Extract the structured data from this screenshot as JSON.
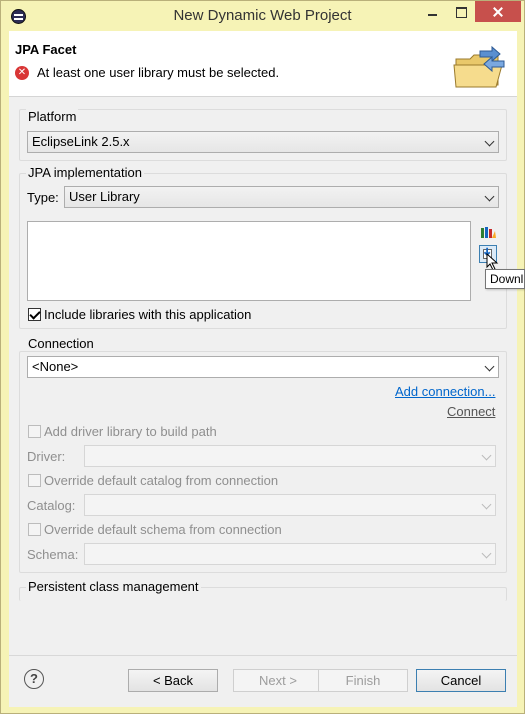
{
  "window": {
    "title": "New Dynamic Web Project"
  },
  "banner": {
    "title": "JPA Facet",
    "error_message": "At least one user library must be selected."
  },
  "platform": {
    "label": "Platform",
    "selected": "EclipseLink 2.5.x"
  },
  "jpa_impl": {
    "label": "JPA implementation",
    "type_label": "Type:",
    "type_selected": "User Library",
    "include_libs_label": "Include libraries with this application",
    "include_libs_checked": true,
    "download_tooltip": "Downl"
  },
  "connection": {
    "label": "Connection",
    "selected": "<None>",
    "add_connection": "Add connection...",
    "connect": "Connect",
    "add_driver_label": "Add driver library to build path",
    "driver_label": "Driver:",
    "override_catalog_label": "Override default catalog from connection",
    "catalog_label": "Catalog:",
    "override_schema_label": "Override default schema from connection",
    "schema_label": "Schema:"
  },
  "persistent": {
    "label": "Persistent class management"
  },
  "buttons": {
    "back": "< Back",
    "next": "Next >",
    "finish": "Finish",
    "cancel": "Cancel"
  },
  "colors": {
    "frame": "#f6f3b6",
    "close_button": "#c7504c",
    "link": "#0066cc",
    "error": "#d93636"
  }
}
